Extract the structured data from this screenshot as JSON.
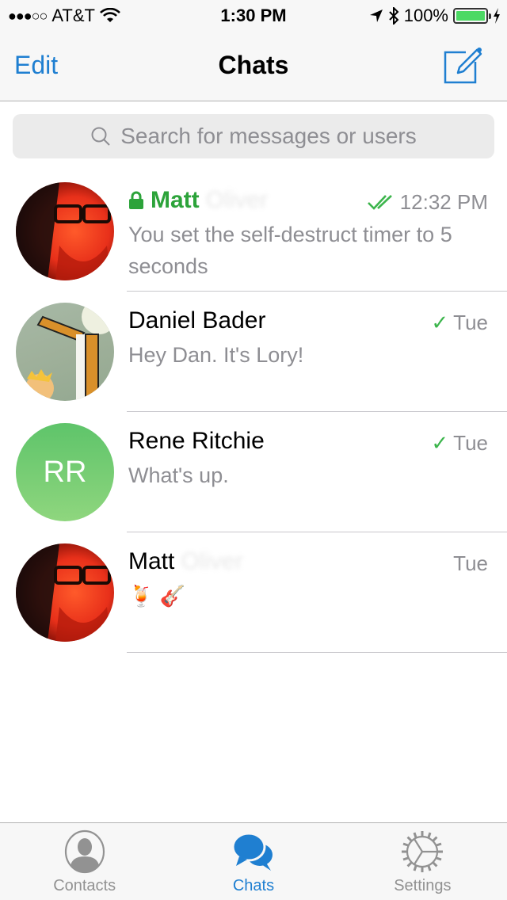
{
  "status_bar": {
    "signal": "●●●○○",
    "carrier": "AT&T",
    "time": "1:30 PM",
    "battery_percent": "100%",
    "battery_level": 1.0
  },
  "nav": {
    "edit_label": "Edit",
    "title": "Chats",
    "compose_icon": "compose-icon"
  },
  "search": {
    "placeholder": "Search for messages or users"
  },
  "chats": [
    {
      "name": "Matt",
      "name_blurred": "Oliver",
      "secret": true,
      "status": "read",
      "time": "12:32 PM",
      "message": "You set the self-destruct timer to 5 seconds",
      "avatar": "photo"
    },
    {
      "name": "Daniel Bader",
      "secret": false,
      "status": "sent",
      "time": "Tue",
      "message": "Hey Dan. It's Lory!",
      "avatar": "photo"
    },
    {
      "name": "Rene Ritchie",
      "secret": false,
      "status": "sent",
      "time": "Tue",
      "message": "What's up.",
      "avatar_initials": "RR",
      "avatar_color": "#6fcb72"
    },
    {
      "name": "Matt",
      "name_blurred": "Oliver",
      "secret": false,
      "status": "none",
      "time": "Tue",
      "message": "🍹 🎸",
      "avatar": "photo"
    }
  ],
  "tabs": [
    {
      "label": "Contacts",
      "icon": "contacts-icon",
      "active": false
    },
    {
      "label": "Chats",
      "icon": "chats-icon",
      "active": true
    },
    {
      "label": "Settings",
      "icon": "settings-icon",
      "active": false
    }
  ],
  "colors": {
    "accent": "#1f7fd1",
    "secret_green": "#2ca33a",
    "check_green": "#3cb54c",
    "muted": "#8e8e93"
  }
}
